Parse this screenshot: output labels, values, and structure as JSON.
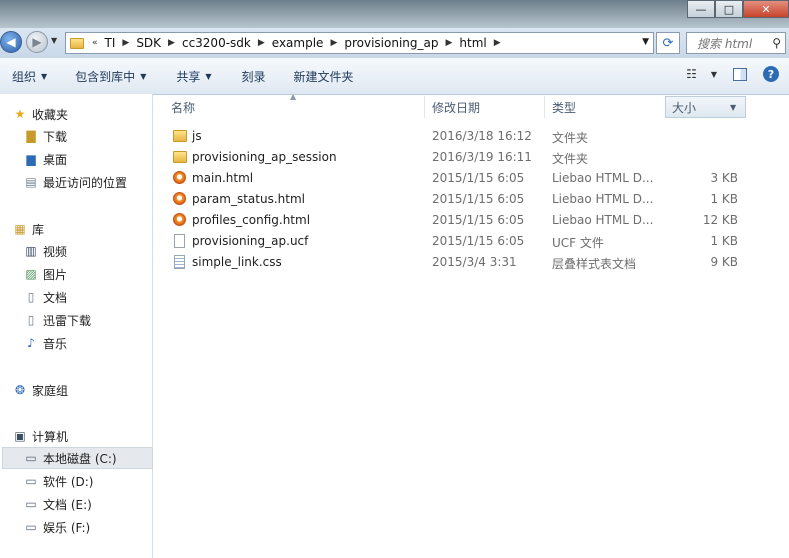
{
  "window": {
    "minimize_label": "—",
    "maximize_label": "□",
    "close_label": "✕"
  },
  "address": {
    "crumbs": [
      "TI",
      "SDK",
      "cc3200-sdk",
      "example",
      "provisioning_ap",
      "html"
    ],
    "lead": "«"
  },
  "search": {
    "placeholder": "搜索 html"
  },
  "toolbar": {
    "organize": "组织",
    "include_library": "包含到库中",
    "share": "共享",
    "burn": "刻录",
    "new_folder": "新建文件夹"
  },
  "sidebar": {
    "favorites": "收藏夹",
    "downloads": "下载",
    "desktop": "桌面",
    "recent": "最近访问的位置",
    "libraries": "库",
    "videos": "视频",
    "pictures": "图片",
    "documents": "文档",
    "thunder": "迅雷下载",
    "music": "音乐",
    "homegroup": "家庭组",
    "computer": "计算机",
    "drive_c": "本地磁盘 (C:)",
    "drive_d": "软件 (D:)",
    "drive_e": "文档 (E:)",
    "drive_f": "娱乐 (F:)"
  },
  "columns": {
    "name": "名称",
    "date": "修改日期",
    "type": "类型",
    "size": "大小"
  },
  "files": [
    {
      "icon": "folder-icon",
      "name": "js",
      "date": "2016/3/18 16:12",
      "type": "文件夹",
      "size": ""
    },
    {
      "icon": "folder-icon",
      "name": "provisioning_ap_session",
      "date": "2016/3/19 16:11",
      "type": "文件夹",
      "size": ""
    },
    {
      "icon": "html-file-icon",
      "name": "main.html",
      "date": "2015/1/15 6:05",
      "type": "Liebao HTML D...",
      "size": "3 KB"
    },
    {
      "icon": "html-file-icon",
      "name": "param_status.html",
      "date": "2015/1/15 6:05",
      "type": "Liebao HTML D...",
      "size": "1 KB"
    },
    {
      "icon": "html-file-icon",
      "name": "profiles_config.html",
      "date": "2015/1/15 6:05",
      "type": "Liebao HTML D...",
      "size": "12 KB"
    },
    {
      "icon": "blank-file-icon",
      "name": "provisioning_ap.ucf",
      "date": "2015/1/15 6:05",
      "type": "UCF 文件",
      "size": "1 KB"
    },
    {
      "icon": "css-file-icon",
      "name": "simple_link.css",
      "date": "2015/3/4 3:31",
      "type": "层叠样式表文档",
      "size": "9 KB"
    }
  ]
}
